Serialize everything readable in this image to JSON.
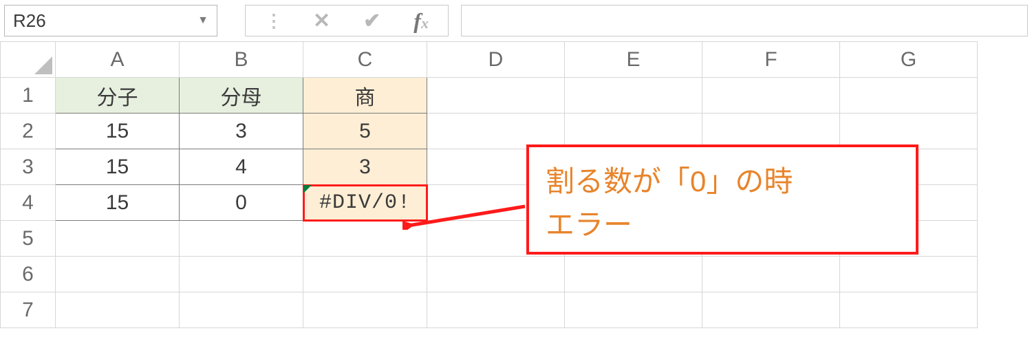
{
  "nameBox": {
    "value": "R26"
  },
  "formula": {
    "value": ""
  },
  "columns": [
    "A",
    "B",
    "C",
    "D",
    "E",
    "F",
    "G"
  ],
  "rows": [
    "1",
    "2",
    "3",
    "4",
    "5",
    "6",
    "7"
  ],
  "headers": {
    "a": "分子",
    "b": "分母",
    "c": "商"
  },
  "data": {
    "r2": {
      "a": "15",
      "b": "3",
      "c": "5"
    },
    "r3": {
      "a": "15",
      "b": "4",
      "c": "3"
    },
    "r4": {
      "a": "15",
      "b": "0",
      "c": "#DIV/0!"
    }
  },
  "callout": "割る数が「0」の時\nエラー"
}
